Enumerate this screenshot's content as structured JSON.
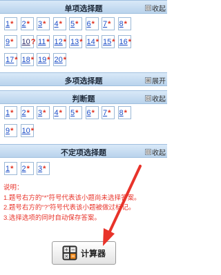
{
  "sections": [
    {
      "title": "单项选择题",
      "toggle": "收起",
      "toggle_symbol": "⊟"
    },
    {
      "title": "多项选择题",
      "toggle": "展开",
      "toggle_symbol": "⊞"
    },
    {
      "title": "判断题",
      "toggle": "收起",
      "toggle_symbol": "⊟"
    },
    {
      "title": "不定项选择题",
      "toggle": "收起",
      "toggle_symbol": "⊟"
    }
  ],
  "single_choice": [
    {
      "num": "1",
      "mark": "*"
    },
    {
      "num": "2",
      "mark": "*"
    },
    {
      "num": "3",
      "mark": "*"
    },
    {
      "num": "4",
      "mark": "*"
    },
    {
      "num": "5",
      "mark": "*"
    },
    {
      "num": "6",
      "mark": "*"
    },
    {
      "num": "7",
      "mark": "*"
    },
    {
      "num": "8",
      "mark": "*"
    },
    {
      "num": "9",
      "mark": "*"
    },
    {
      "num": "10",
      "mark": "?"
    },
    {
      "num": "11",
      "mark": "*"
    },
    {
      "num": "12",
      "mark": "*"
    },
    {
      "num": "13",
      "mark": "*"
    },
    {
      "num": "14",
      "mark": "*"
    },
    {
      "num": "15",
      "mark": "*"
    },
    {
      "num": "16",
      "mark": "*"
    },
    {
      "num": "17",
      "mark": "*"
    },
    {
      "num": "18",
      "mark": "*"
    },
    {
      "num": "19",
      "mark": "*"
    },
    {
      "num": "20",
      "mark": "*"
    }
  ],
  "true_false": [
    {
      "num": "1",
      "mark": "*"
    },
    {
      "num": "2",
      "mark": "*"
    },
    {
      "num": "3",
      "mark": "*"
    },
    {
      "num": "4",
      "mark": "*"
    },
    {
      "num": "5",
      "mark": "*"
    },
    {
      "num": "6",
      "mark": "*"
    },
    {
      "num": "7",
      "mark": "*"
    },
    {
      "num": "8",
      "mark": "*"
    },
    {
      "num": "9",
      "mark": "*"
    },
    {
      "num": "10",
      "mark": "*"
    }
  ],
  "indefinite_choice": [
    {
      "num": "1",
      "mark": "*"
    },
    {
      "num": "2",
      "mark": "*"
    },
    {
      "num": "3",
      "mark": "*"
    }
  ],
  "notes": {
    "heading": "说明：",
    "line1": "1.题号右方的“*”符号代表该小题尚未选择答案。",
    "line2": "2.题号右方的“?”符号代表该小题被做过标记。",
    "line3": "3.选择选项的同时自动保存答案。"
  },
  "calculator": {
    "label": "计算器"
  },
  "colors": {
    "number": "#1a4dc7",
    "mark": "#e0301e",
    "notes": "#e8332a",
    "arrow": "#e8332a",
    "header": "#c9def2"
  }
}
